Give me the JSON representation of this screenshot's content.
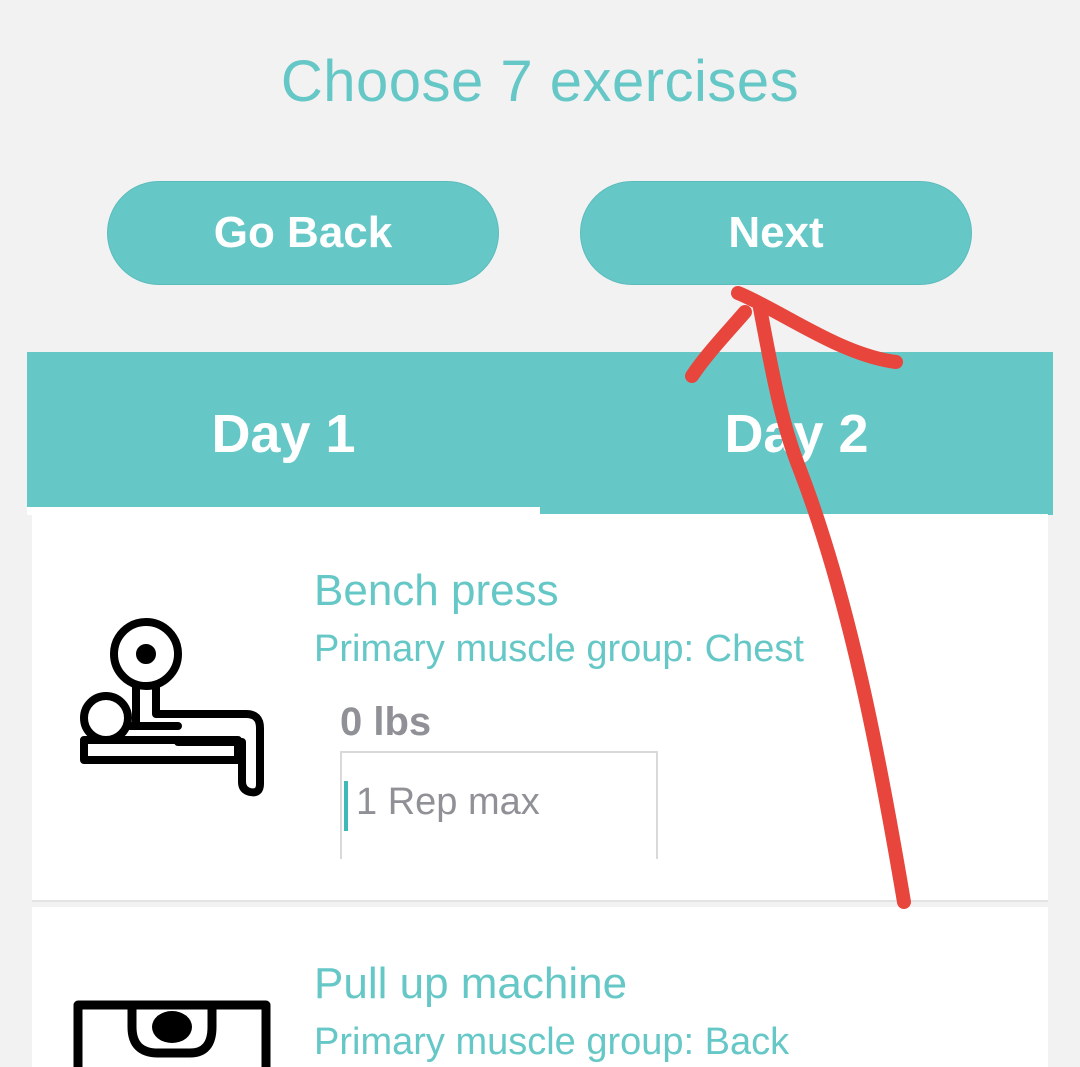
{
  "header": {
    "title": "Choose 7 exercises"
  },
  "buttons": {
    "back_label": "Go Back",
    "next_label": "Next"
  },
  "tabs": [
    {
      "label": "Day 1",
      "selected": true
    },
    {
      "label": "Day 2",
      "selected": false
    }
  ],
  "exercises": [
    {
      "name": "Bench press",
      "muscle": "Primary muscle group: Chest",
      "weight": "0 lbs",
      "rep_placeholder": "1 Rep max",
      "icon": "bench-press-icon"
    },
    {
      "name": "Pull up machine",
      "muscle": "Primary muscle group: Back",
      "icon": "pull-up-machine-icon"
    }
  ],
  "colors": {
    "accent": "#66c7c7",
    "background": "#f2f2f2",
    "muted_text": "#8f9196",
    "annotation": "#e8453c"
  }
}
